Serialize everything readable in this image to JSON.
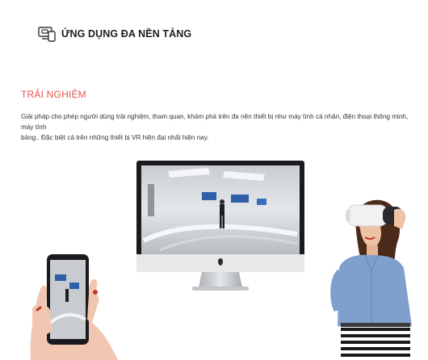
{
  "header": {
    "title": "ỨNG DỤNG ĐA NỀN TẢNG",
    "icon": "multi-device-icon"
  },
  "section": {
    "title": "TRẢI NGHIỆM",
    "title_color": "#e0564f"
  },
  "description": {
    "line1": "Giải pháp cho phép người dùng trải nghiệm, tham quan, khám phá trên đa nền thiết bị như máy tính cá nhân, điện thoại thông minh, máy tính",
    "line2": "bảng.. Đặc biệt cả trên những thiết bị VR hiện đại nhất hiện nay."
  }
}
